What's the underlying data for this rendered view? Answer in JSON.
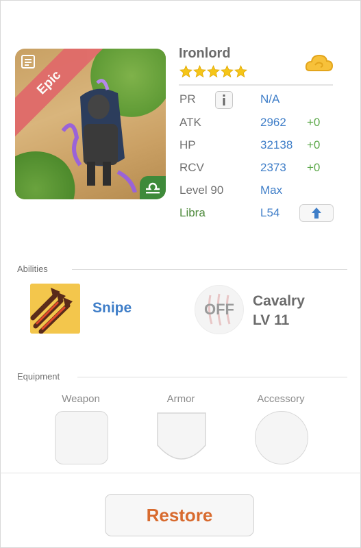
{
  "hero": {
    "name": "Ironlord",
    "rarity": "Epic",
    "stars": 5,
    "accent_star_color": "#f5c518"
  },
  "stats": {
    "pr": {
      "label": "PR",
      "value": "N/A"
    },
    "atk": {
      "label": "ATK",
      "value": "2962",
      "bonus": "+0"
    },
    "hp": {
      "label": "HP",
      "value": "32138",
      "bonus": "+0"
    },
    "rcv": {
      "label": "RCV",
      "value": "2373",
      "bonus": "+0"
    },
    "level": {
      "label": "Level 90",
      "value": "Max"
    },
    "sign": {
      "label": "Libra",
      "value": "L54"
    }
  },
  "abilities": {
    "title": "Abilities",
    "skill_name": "Snipe",
    "toggle_text": "OFF",
    "passive_name": "Cavalry",
    "passive_level": "LV 11"
  },
  "equipment": {
    "title": "Equipment",
    "weapon": "Weapon",
    "armor": "Armor",
    "accessory": "Accessory"
  },
  "footer": {
    "restore_label": "Restore"
  },
  "colors": {
    "value_blue": "#3f7ec8",
    "bonus_green": "#5ca84a",
    "restore_orange": "#d86b2f",
    "epic_red": "#e06a6a"
  }
}
